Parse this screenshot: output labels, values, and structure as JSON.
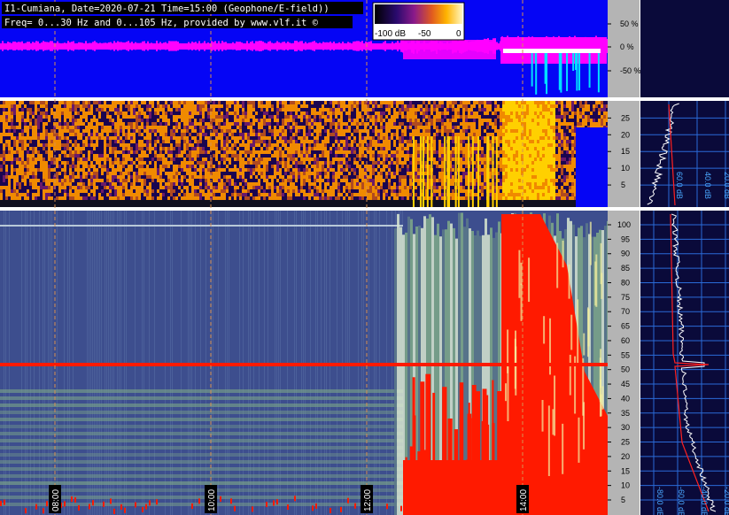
{
  "header": {
    "line1": "I1-Cumiana, Date=2020-07-21 Time=15:00 (Geophone/E-field))",
    "line2": "Freq= 0...30 Hz and 0...105 Hz, provided by www.vlf.it ©"
  },
  "colorbar": {
    "labels": [
      "-100 dB",
      "-50",
      "0"
    ]
  },
  "colors": {
    "deep_blue": "#0505f5",
    "magenta": "#ff00ff",
    "cyan": "#00e0ff",
    "heat_dark": "#1a0550",
    "heat_orange": "#f08a00",
    "heat_yellow": "#ffd000",
    "low_blue": "#3d4e8e",
    "low_green": "#7faa88",
    "hot_red": "#ff1a00",
    "axis_gray": "#b4b4b4",
    "side_bg": "#0a0a3a",
    "grid_blue": "#2a6bd8",
    "grid_light": "#4aa8ff",
    "trace_white": "#ffffff",
    "trace_red": "#ff2020",
    "marker_dash": "#d89050"
  },
  "time_labels": [
    "08:00",
    "10:00",
    "12:00",
    "14:00"
  ],
  "chart_data": [
    {
      "type": "area",
      "panel": "top strip (percentage activity)",
      "ticks": [
        "50 %",
        "0 %",
        "-50 %"
      ],
      "ylim": [
        -100,
        100
      ]
    },
    {
      "type": "heatmap",
      "panel": "upper spectrogram",
      "x_ticks": [
        "08:00",
        "10:00",
        "12:00",
        "14:00"
      ],
      "y_ticks": [
        5,
        10,
        15,
        20,
        25
      ],
      "ylim": [
        0,
        30
      ]
    },
    {
      "type": "heatmap",
      "panel": "lower spectrogram",
      "x_ticks": [
        "08:00",
        "10:00",
        "12:00",
        "14:00"
      ],
      "y_ticks": [
        5,
        10,
        15,
        20,
        25,
        30,
        35,
        40,
        45,
        50,
        55,
        60,
        65,
        70,
        75,
        80,
        85,
        90,
        95,
        100
      ],
      "ylim": [
        0,
        105
      ]
    },
    {
      "type": "line",
      "panel": "upper side spectrum",
      "x_ticks": [
        "60.0 dB",
        "40.0 dB",
        "20.0 dB"
      ],
      "ylim": [
        0,
        30
      ]
    },
    {
      "type": "line",
      "panel": "lower side spectrum",
      "x_ticks": [
        "-80.0 dB",
        "-60.0 dB",
        "-40.0 dB",
        "-20.0 dB"
      ],
      "ylim": [
        0,
        105
      ]
    }
  ]
}
